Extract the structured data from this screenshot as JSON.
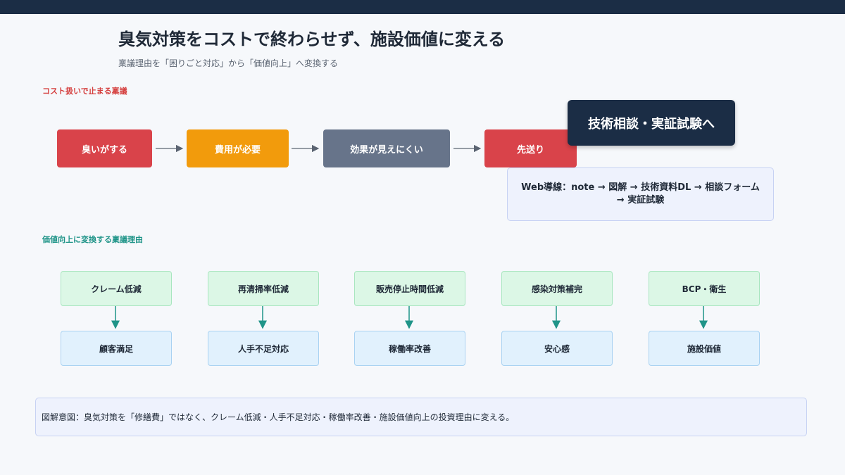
{
  "title": "臭気対策をコストで終わらせず、施設価値に変える",
  "subtitle": "稟議理由を「困りごと対応」から「価値向上」へ変換する",
  "section_cost": "コスト扱いで止まる稟議",
  "section_value": "価値向上に変換する稟議理由",
  "cost_flow": [
    "臭いがする",
    "費用が必要",
    "効果が見えにくい",
    "先送り"
  ],
  "cta": "技術相談・実証試験へ",
  "web_path": {
    "line1": "Web導線：note → 図解 → 技術資料DL → 相談フォーム",
    "line2": "→ 実証試験"
  },
  "value_pairs": [
    {
      "from": "クレーム低減",
      "to": "顧客満足"
    },
    {
      "from": "再清掃率低減",
      "to": "人手不足対応"
    },
    {
      "from": "販売停止時間低減",
      "to": "稼働率改善"
    },
    {
      "from": "感染対策補完",
      "to": "安心感"
    },
    {
      "from": "BCP・衛生",
      "to": "施設価値"
    }
  ],
  "note": "図解意図：臭気対策を「修繕費」ではなく、クレーム低減・人手不足対応・稼働率改善・施設価値向上の投資理由に変える。",
  "colors": {
    "header_bar": "#1b2d45",
    "red": "#d9434a",
    "orange": "#f29b0c",
    "slate": "#67748a",
    "teal": "#1f9488",
    "green_box": "#dcf7e6",
    "blue_box": "#e1f1fd"
  }
}
